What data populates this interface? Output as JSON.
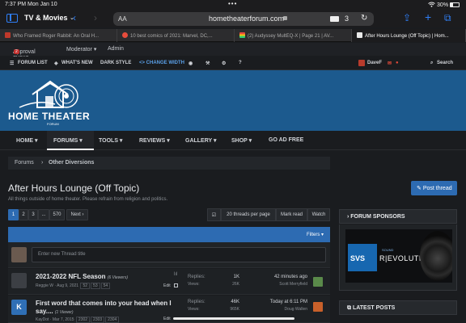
{
  "status_bar": {
    "time_date": "7:37 PM   Mon Jan 10",
    "dots": "•••",
    "battery": "30%"
  },
  "safari": {
    "app_label": "TV & Movies",
    "aa": "AA",
    "url": "hometheaterforum.com",
    "tab_count": "3"
  },
  "tabs": [
    {
      "label": "Who Framed Roger Rabbit: An Oral H...",
      "color": "#c0392b"
    },
    {
      "label": "10 best comics of 2021: Marvel, DC,...",
      "color": "#e74c3c"
    },
    {
      "label": "(2) Audyssey MultEQ-X | Page 21 | AV...",
      "color": "#2ecc71"
    },
    {
      "label": "After Hours Lounge (Off Topic) | Hom...",
      "color": "#2c5f8f"
    }
  ],
  "staff_bar": {
    "approval_queue": "Approval queue",
    "approval_count": "2",
    "moderator": "Moderator ▾",
    "admin": "Admin"
  },
  "top_nav": {
    "forum_list": "FORUM LIST",
    "whats_new": "WHAT'S NEW",
    "dark_style": "DARK STYLE",
    "change_width": "<> CHANGE WIDTH",
    "user": "DaveF",
    "search": "Search"
  },
  "logo": {
    "text": "HOME THEATER",
    "sub": "FORUM"
  },
  "main_nav": [
    "HOME ▾",
    "FORUMS ▾",
    "TOOLS ▾",
    "REVIEWS ▾",
    "GALLERY ▾",
    "SHOP ▾",
    "GO AD FREE"
  ],
  "breadcrumb": {
    "root": "Forums",
    "current": "Other Diversions"
  },
  "page": {
    "title": "After Hours Lounge (Off Topic)",
    "description": "All things outside of home theater. Please refrain from religion and politics.",
    "post_thread": "Post thread"
  },
  "pagination": {
    "pages": [
      "1",
      "2",
      "3",
      "...",
      "570"
    ],
    "next": "Next ›"
  },
  "tools": {
    "per_page": "20 threads per page",
    "mark_read": "Mark read",
    "watch": "Watch"
  },
  "filters": "Filters ▾",
  "new_thread_placeholder": "Enter new Thread title",
  "threads": [
    {
      "title": "2021-2022 NFL Season",
      "viewers": "(6 Viewers)",
      "starter": "Reggie W · Aug 9, 2021",
      "pages": [
        "52",
        "53",
        "54"
      ],
      "replies_label": "Replies:",
      "replies": "1K",
      "views_label": "Views:",
      "views": "26K",
      "last_time": "42 minutes ago",
      "last_user": "Scott Merryfield",
      "edit": "Edit"
    },
    {
      "title": "First word that comes into your head when I",
      "title2": "say....",
      "viewers": "(1 Viewer)",
      "starter": "KayDot · Mar 7, 2015",
      "pages": [
        "2302",
        "2303",
        "2304"
      ],
      "replies_label": "Replies:",
      "replies": "46K",
      "views_label": "Views:",
      "views": "965K",
      "last_time": "Today at 6:11 PM",
      "last_user": "Doug Wallen",
      "edit": "Edit"
    }
  ],
  "sidebar": {
    "sponsors_title": "FORUM SPONSORS",
    "banner": {
      "brand": "SVS",
      "sound": "SOUND",
      "revolution": "R|EVOLUTION"
    },
    "latest_title": "LATEST POSTS"
  }
}
